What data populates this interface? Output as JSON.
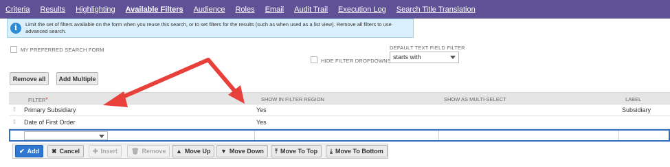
{
  "tabs": [
    {
      "label": "Criteria",
      "active": false
    },
    {
      "label": "Results",
      "active": false
    },
    {
      "label": "Highlighting",
      "active": false
    },
    {
      "label": "Available Filters",
      "active": true
    },
    {
      "label": "Audience",
      "active": false
    },
    {
      "label": "Roles",
      "active": false
    },
    {
      "label": "Email",
      "active": false
    },
    {
      "label": "Audit Trail",
      "active": false
    },
    {
      "label": "Execution Log",
      "active": false
    },
    {
      "label": "Search Title Translation",
      "active": false
    }
  ],
  "info_message": "Limit the set of filters available on the form when you reuse this search, or to set filters for the results (such as when used as a list view). Remove all filters to use advanced search.",
  "options": {
    "preferred_form_label": "MY PREFERRED SEARCH FORM",
    "hide_dropdowns_label": "HIDE FILTER DROPDOWNS",
    "default_text_filter_label": "DEFAULT TEXT FIELD FILTER",
    "default_text_filter_value": "starts with"
  },
  "buttons": {
    "remove_all": "Remove all",
    "add_multiple": "Add Multiple"
  },
  "grid": {
    "headers": {
      "filter": "FILTER",
      "required_mark": "*",
      "show_in_region": "SHOW IN FILTER REGION",
      "multi_select": "SHOW AS MULTI-SELECT",
      "label": "LABEL"
    },
    "rows": [
      {
        "filter": "Primary Subsidiary",
        "show_in_region": "Yes",
        "multi_select": "",
        "label": "Subsidiary"
      },
      {
        "filter": "Date of First Order",
        "show_in_region": "Yes",
        "multi_select": "",
        "label": ""
      }
    ]
  },
  "toolbar": {
    "add": "Add",
    "cancel": "Cancel",
    "insert": "Insert",
    "remove": "Remove",
    "move_up": "Move Up",
    "move_down": "Move Down",
    "move_to_top": "Move To Top",
    "move_to_bottom": "Move To Bottom"
  },
  "icons": {
    "info": "info-icon",
    "add": "check-icon",
    "cancel": "x-icon",
    "insert": "plus-icon",
    "remove": "trash-icon",
    "move_up": "arrow-up-icon",
    "move_down": "arrow-down-icon",
    "move_to_top": "arrow-to-top-icon",
    "move_to_bottom": "arrow-to-bottom-icon"
  },
  "colors": {
    "tab_bar": "#5f5196",
    "info_bg": "#d9effb",
    "primary_button": "#2f78d1",
    "annotation_arrow": "#e8403a"
  }
}
